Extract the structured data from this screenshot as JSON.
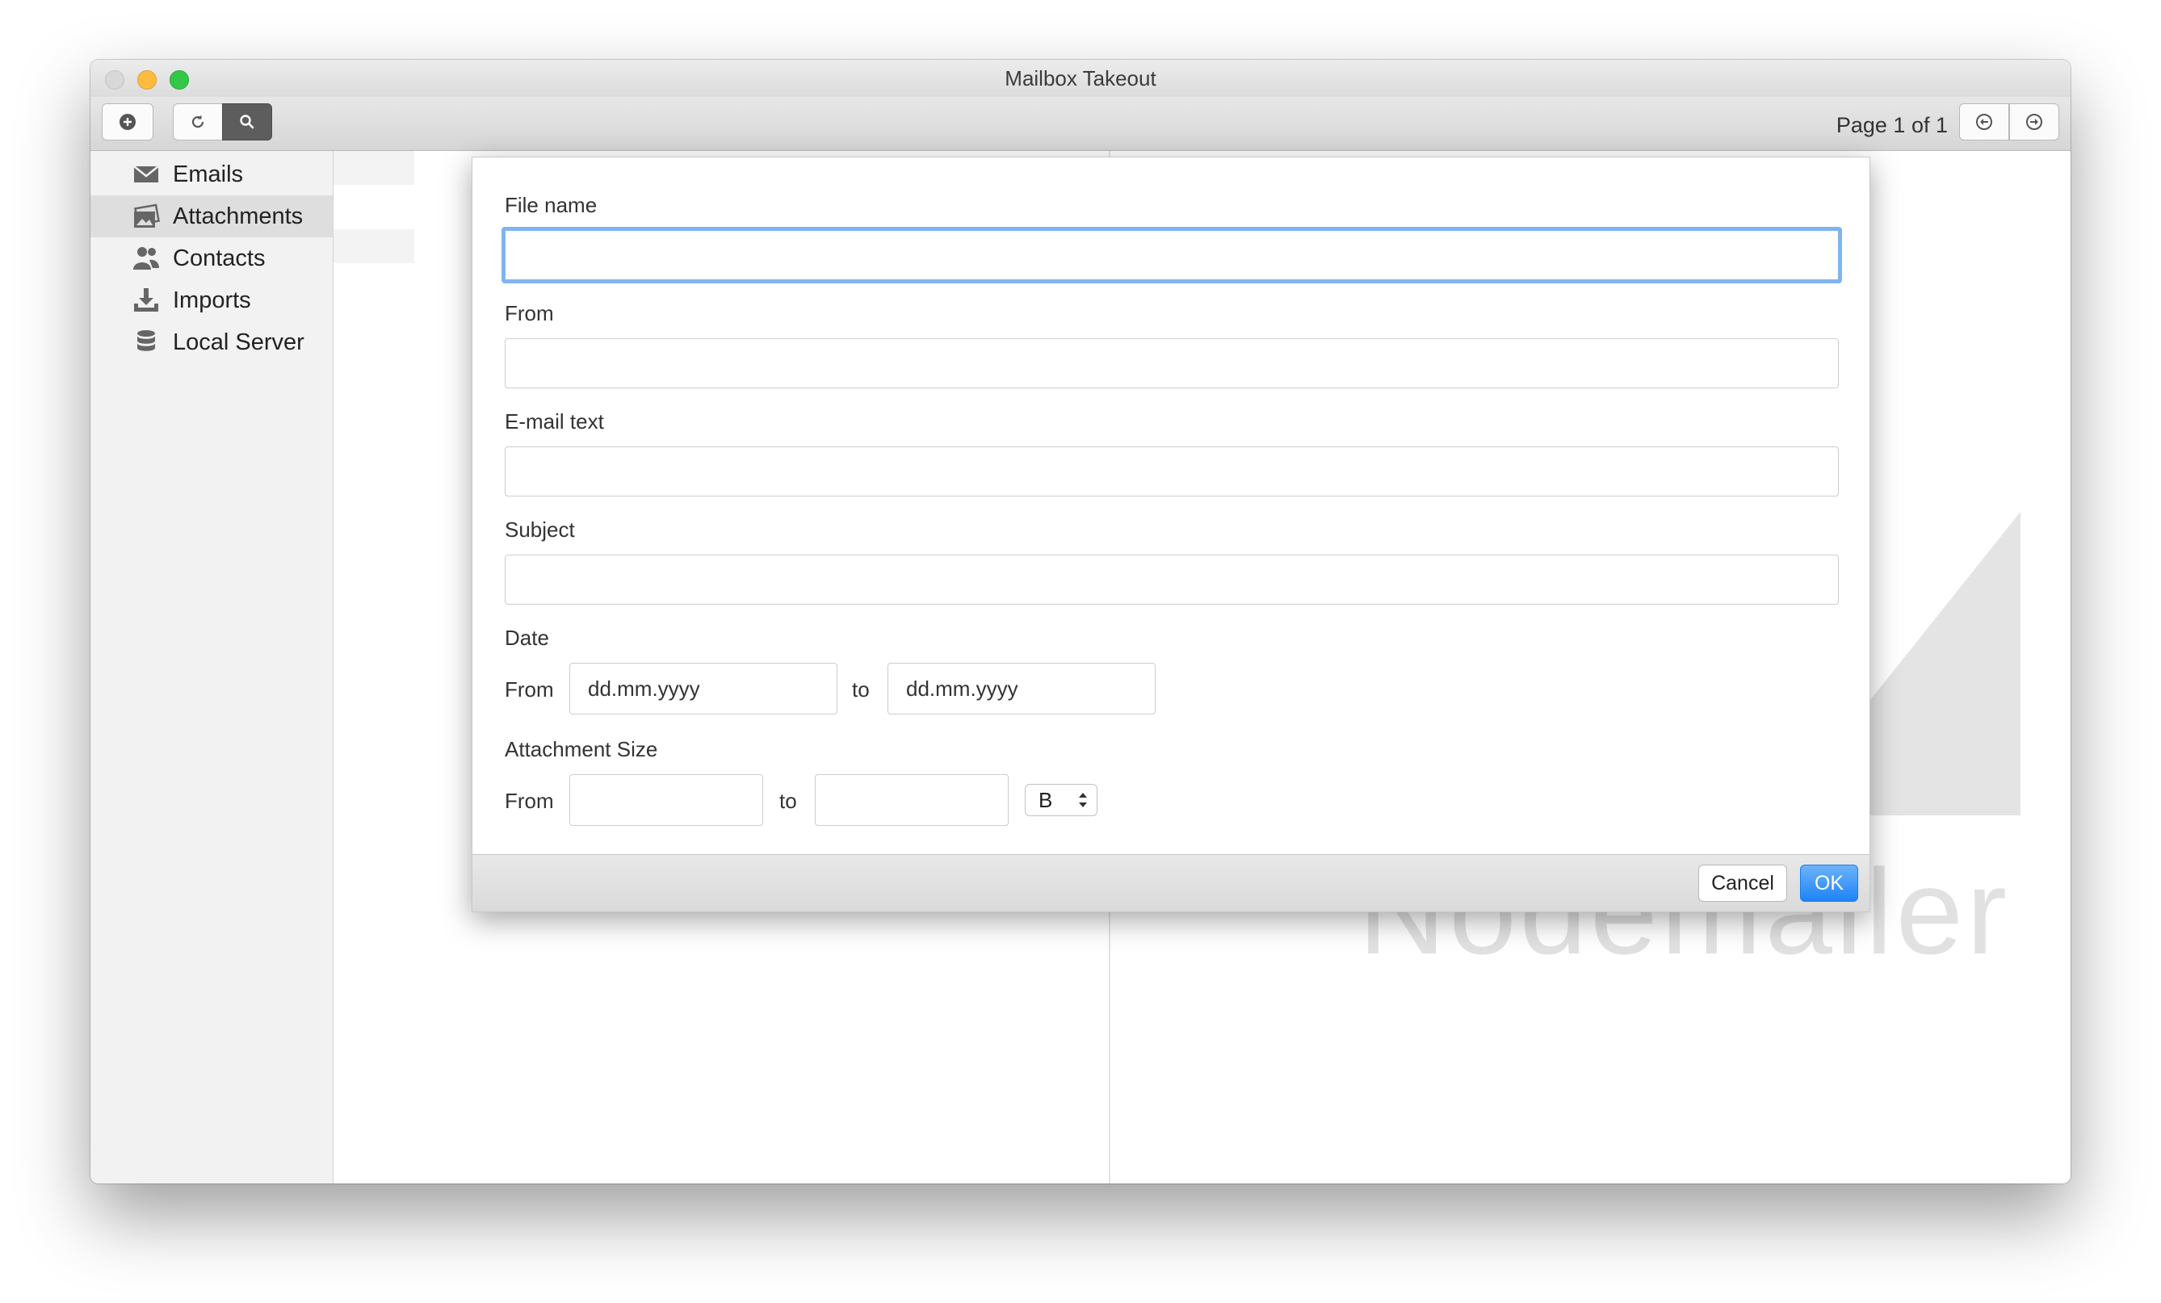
{
  "window": {
    "title": "Mailbox Takeout"
  },
  "toolbar": {
    "pager_label": "Page 1 of 1"
  },
  "sidebar": {
    "items": [
      {
        "label": "Emails",
        "icon": "envelope-icon"
      },
      {
        "label": "Attachments",
        "icon": "image-stack-icon",
        "active": true
      },
      {
        "label": "Contacts",
        "icon": "people-icon"
      },
      {
        "label": "Imports",
        "icon": "download-tray-icon"
      },
      {
        "label": "Local Server",
        "icon": "database-icon"
      }
    ]
  },
  "background": {
    "logo_text": "Nodemailer"
  },
  "dialog": {
    "file_name": {
      "label": "File name",
      "value": ""
    },
    "from": {
      "label": "From",
      "value": ""
    },
    "email_text": {
      "label": "E-mail text",
      "value": ""
    },
    "subject": {
      "label": "Subject",
      "value": ""
    },
    "date": {
      "label": "Date",
      "from_label": "From",
      "to_label": "to",
      "from_placeholder": "dd.mm.yyyy",
      "to_placeholder": "dd.mm.yyyy"
    },
    "attachment_size": {
      "label": "Attachment Size",
      "from_label": "From",
      "to_label": "to",
      "from_value": "",
      "to_value": "",
      "unit": "B"
    },
    "buttons": {
      "cancel": "Cancel",
      "ok": "OK"
    }
  },
  "colors": {
    "focus_ring": "#80b4ef",
    "ok_button": "#1e83f7",
    "sidebar_active": "#dedede"
  }
}
